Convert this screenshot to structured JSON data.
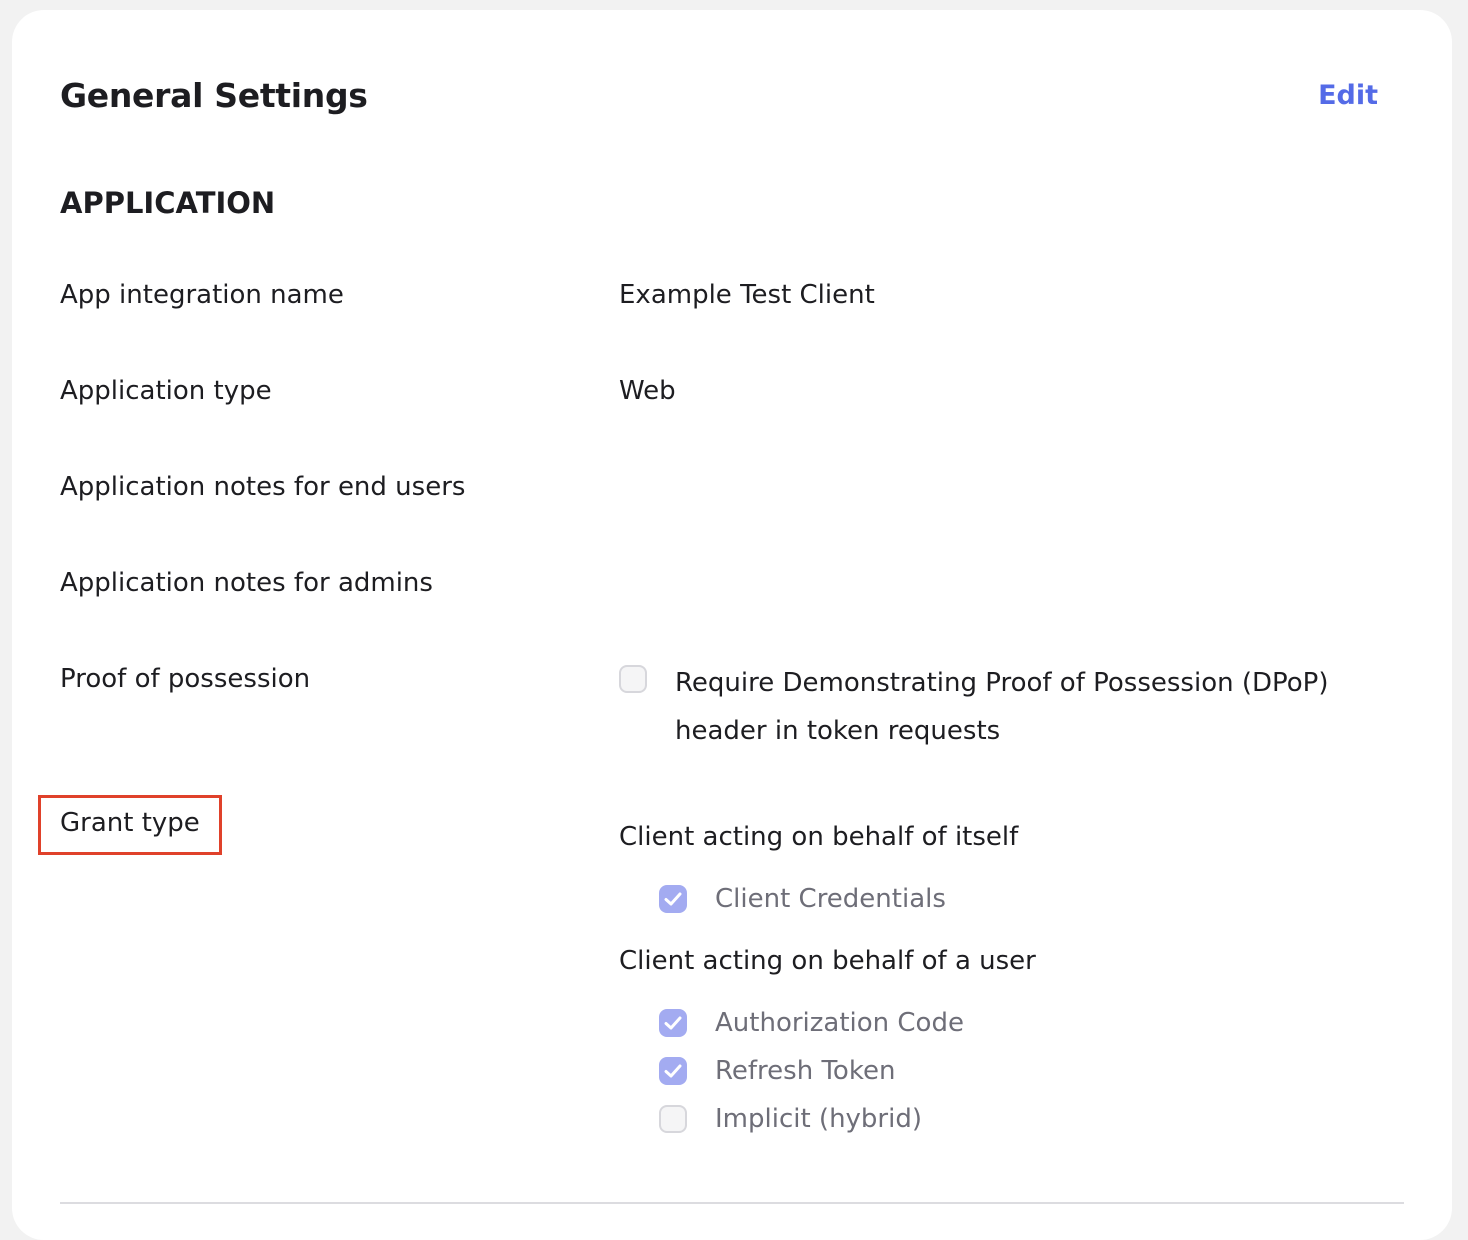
{
  "header": {
    "title": "General Settings",
    "edit_label": "Edit"
  },
  "section": {
    "title": "APPLICATION"
  },
  "fields": {
    "app_name": {
      "label": "App integration name",
      "value": "Example Test Client"
    },
    "app_type": {
      "label": "Application type",
      "value": "Web"
    },
    "notes_end_users": {
      "label": "Application notes for end users",
      "value": ""
    },
    "notes_admins": {
      "label": "Application notes for admins",
      "value": ""
    },
    "proof_of_possession": {
      "label": "Proof of possession",
      "option": {
        "text": "Require Demonstrating Proof of Possession (DPoP) header in token requests",
        "checked": false
      }
    },
    "grant_type": {
      "label": "Grant type",
      "group_itself": {
        "title": "Client acting on behalf of itself",
        "options": [
          {
            "label": "Client Credentials",
            "checked": true
          }
        ]
      },
      "group_user": {
        "title": "Client acting on behalf of a user",
        "options": [
          {
            "label": "Authorization Code",
            "checked": true
          },
          {
            "label": "Refresh Token",
            "checked": true
          },
          {
            "label": "Implicit (hybrid)",
            "checked": false
          }
        ]
      }
    }
  },
  "colors": {
    "accent": "#546be7",
    "checkbox_checked": "#a3abf1",
    "highlight_border": "#e0412a"
  },
  "icons": {
    "check": "check-icon"
  }
}
